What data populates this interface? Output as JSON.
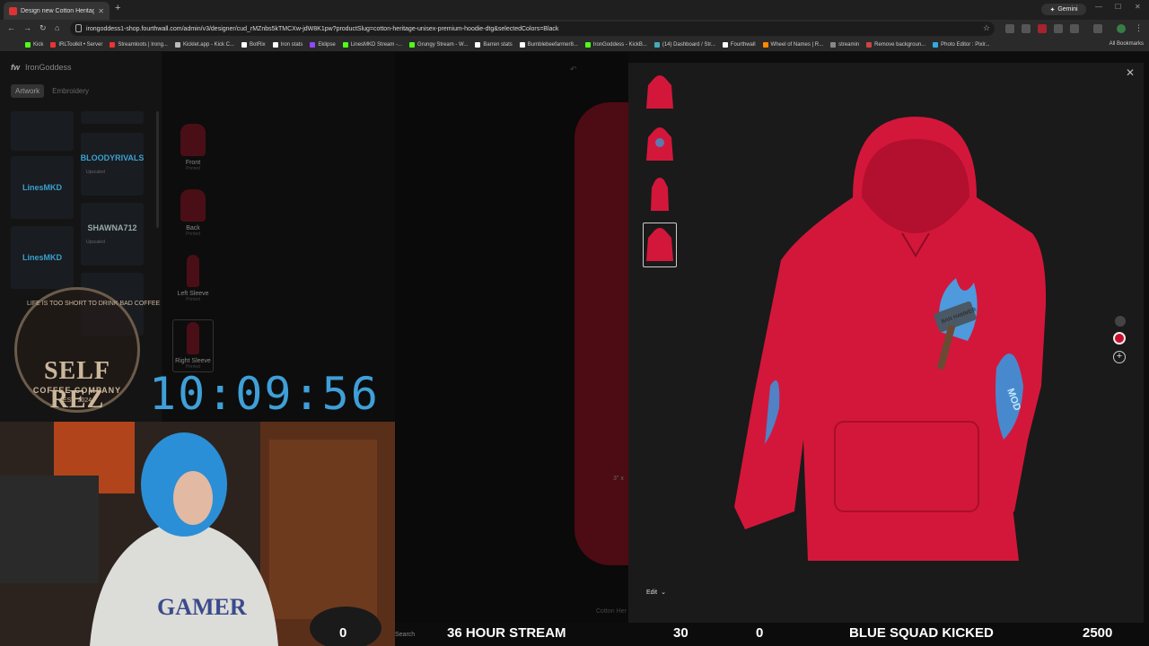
{
  "browser": {
    "tab_title": "Design new Cotton Heritage U",
    "url": "irongoddess1-shop.fourthwall.com/admin/v3/designer/cud_rMZnbs5kTMCXw-jdW8K1pw?productSlug=cotton-heritage-unisex-premium-hoodie-dtg&selectedColors=Black",
    "gemini_label": "Gemini",
    "bookmarks": [
      "Kick",
      "IRLToolkit • Server",
      "Streamloots | Irong...",
      "Kicklet.app - Kick C...",
      "BotRix",
      "Iron stats",
      "Eklipse",
      "LinesMKD Stream -...",
      "Grungy Stream - W...",
      "Barren stats",
      "Bumblebeefarmer8...",
      "IronGoddess - KickB...",
      "(14) Dashboard / Str...",
      "Fourthwall",
      "Wheel of Names | R...",
      "streamin",
      "Remove backgroun...",
      "Photo Editor : Pixlr..."
    ],
    "all_bookmarks": "All Bookmarks"
  },
  "app": {
    "logo_mark": "fw",
    "store_name": "IronGoddess",
    "tabs": [
      "Artwork",
      "Embroidery"
    ],
    "thumbs": [
      {
        "title": "BLOODYRIVALS",
        "sub": "Upscaled"
      },
      {
        "title": "SHAWNA712",
        "sub": "Upscaled"
      }
    ],
    "views": [
      {
        "label": "Front",
        "sub": "Printed"
      },
      {
        "label": "Back",
        "sub": "Printed"
      },
      {
        "label": "Left Sleeve",
        "sub": "Printed"
      },
      {
        "label": "Right Sleeve",
        "sub": "Printed"
      }
    ],
    "size_hint": "3\" x",
    "footer_text": "Cotton Her"
  },
  "modal": {
    "edit_label": "Edit",
    "hammer_text": "BAN HAMMER",
    "sleeve_text": "MOD",
    "colors": {
      "hoodie": "#d3173a",
      "selected_swatch": "#c8102e"
    }
  },
  "overlay": {
    "badge_arc": "LIFE IS TOO SHORT TO DRINK BAD COFFEE",
    "badge_title": "SELF REZ",
    "badge_sub": "COFFEE COMPANY",
    "badge_est": "EST. 2024",
    "timer": "10:09:56",
    "ticker": {
      "left_count": "0",
      "search": "Search",
      "stream_title": "36 HOUR STREAM",
      "count_30": "30",
      "count_0": "0",
      "kicked": "BLUE SQUAD KICKED",
      "total": "2500"
    }
  }
}
